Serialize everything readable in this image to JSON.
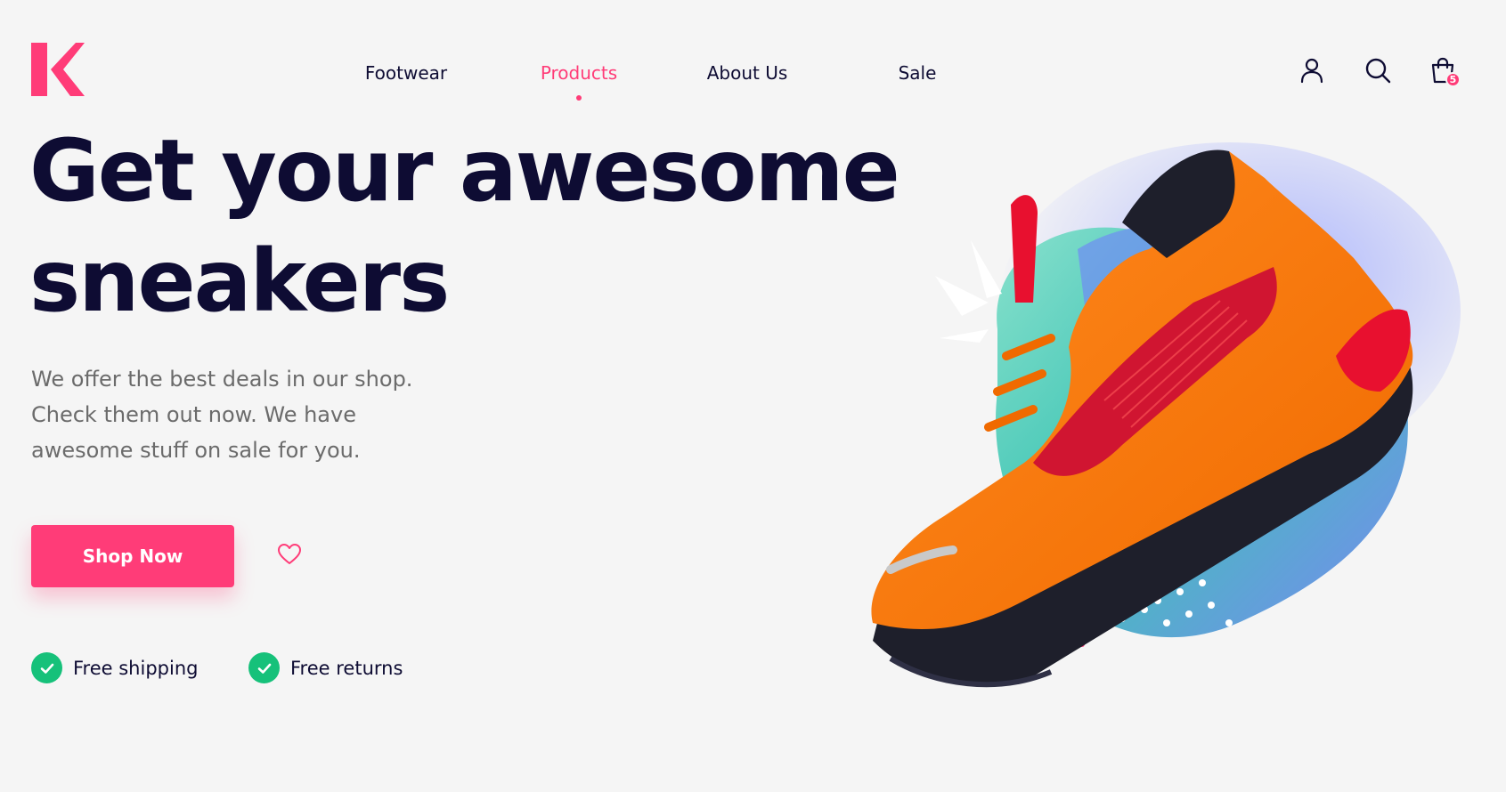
{
  "brand": {
    "logo_letter": "K",
    "accent_color": "#ff3c78"
  },
  "nav": {
    "items": [
      {
        "label": "Footwear",
        "active": false
      },
      {
        "label": "Products",
        "active": true
      },
      {
        "label": "About Us",
        "active": false
      },
      {
        "label": "Sale",
        "active": false
      }
    ]
  },
  "header_icons": {
    "account": "user-icon",
    "search": "search-icon",
    "cart": "shopping-bag-icon",
    "cart_count": "5"
  },
  "hero": {
    "headline_line1": "Get your awesome",
    "headline_line2": "sneakers",
    "subtext_line1": "We offer the best deals in our shop.",
    "subtext_line2": "Check them out now. We have",
    "subtext_line3": "awesome stuff on sale for you.",
    "cta_label": "Shop Now",
    "wishlist_icon": "heart-icon"
  },
  "perks": [
    {
      "label": "Free shipping",
      "icon": "check-circle-icon"
    },
    {
      "label": "Free returns",
      "icon": "check-circle-icon"
    }
  ],
  "colors": {
    "text_dark": "#0e0c33",
    "text_muted": "#6b6b6b",
    "success": "#16c17a",
    "background": "#f5f5f5"
  }
}
